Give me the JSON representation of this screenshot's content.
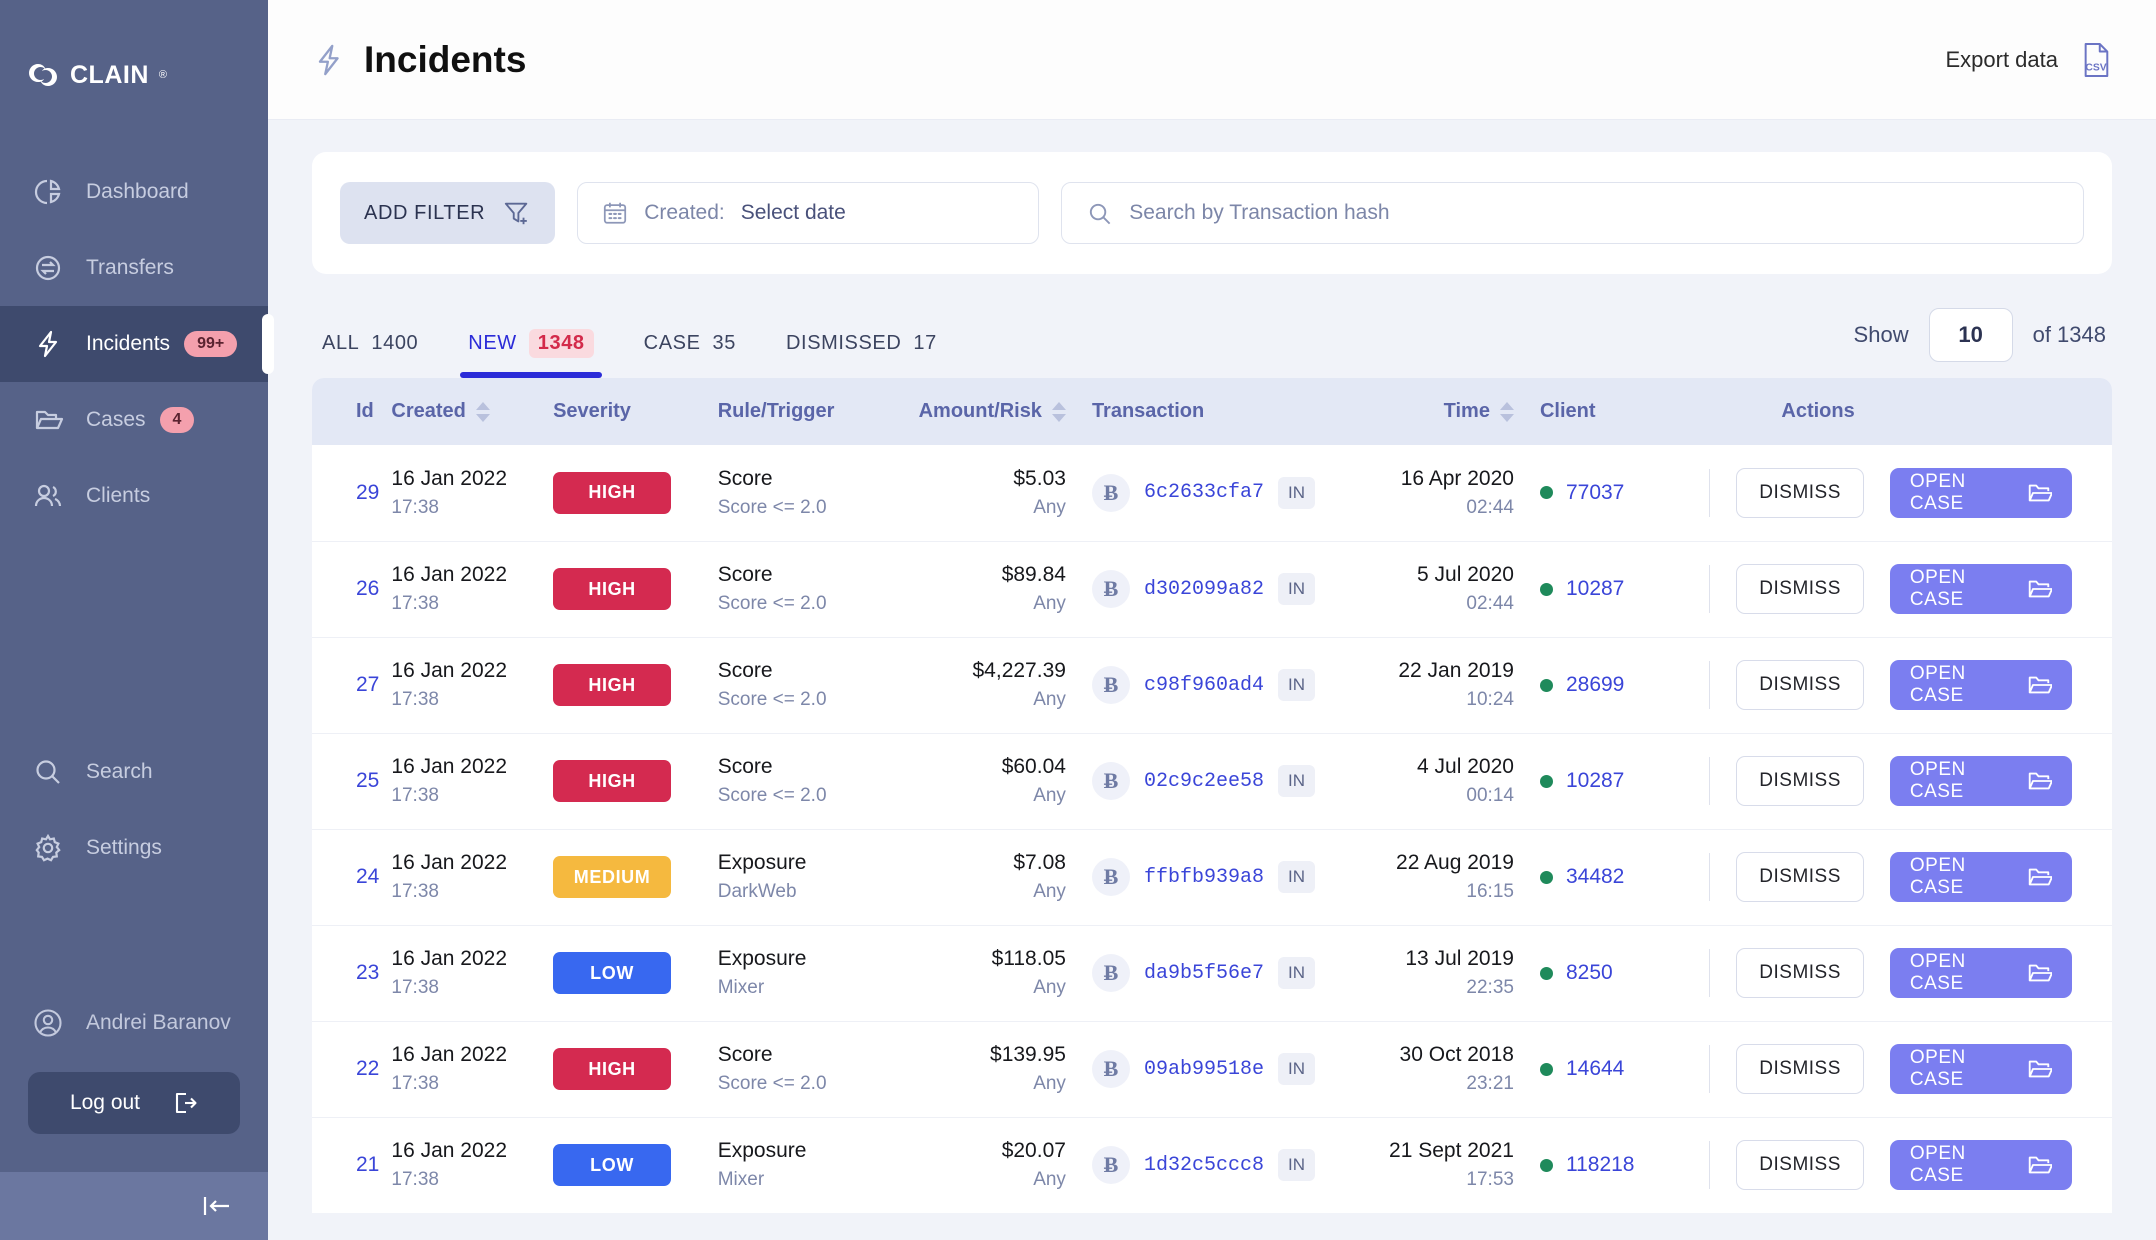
{
  "brand": {
    "name": "CLAIN",
    "registered": "®"
  },
  "sidebar": {
    "items": [
      {
        "label": "Dashboard",
        "icon": "pie-chart-icon",
        "badge": null,
        "active": false
      },
      {
        "label": "Transfers",
        "icon": "transfers-icon",
        "badge": null,
        "active": false
      },
      {
        "label": "Incidents",
        "icon": "bolt-icon",
        "badge": "99+",
        "active": true
      },
      {
        "label": "Cases",
        "icon": "folder-icon",
        "badge": "4",
        "active": false
      },
      {
        "label": "Clients",
        "icon": "users-icon",
        "badge": null,
        "active": false
      }
    ],
    "lower_items": [
      {
        "label": "Search",
        "icon": "search-icon"
      },
      {
        "label": "Settings",
        "icon": "gear-icon"
      }
    ],
    "profile": {
      "name": "Andrei Baranov",
      "icon": "user-circle-icon"
    },
    "logout": {
      "label": "Log out",
      "icon": "logout-icon"
    },
    "collapse": {
      "icon": "collapse-left-icon"
    }
  },
  "header": {
    "title": "Incidents",
    "title_icon": "bolt-icon",
    "export_label": "Export data",
    "export_icon": "csv-file-icon"
  },
  "filters": {
    "add_filter_label": "ADD FILTER",
    "add_filter_icon": "funnel-plus-icon",
    "created": {
      "icon": "calendar-icon",
      "label": "Created:",
      "value": "Select date"
    },
    "search": {
      "icon": "search-icon",
      "placeholder": "Search by Transaction hash"
    }
  },
  "tabs": [
    {
      "label": "ALL",
      "count": "1400",
      "active": false
    },
    {
      "label": "NEW",
      "count": "1348",
      "active": true
    },
    {
      "label": "CASE",
      "count": "35",
      "active": false
    },
    {
      "label": "DISMISSED",
      "count": "17",
      "active": false
    }
  ],
  "pagination": {
    "show_label": "Show",
    "page_size": "10",
    "of_label": "of 1348"
  },
  "table": {
    "columns": [
      {
        "key": "id",
        "label": "Id",
        "sortable": false
      },
      {
        "key": "created",
        "label": "Created",
        "sortable": true
      },
      {
        "key": "severity",
        "label": "Severity",
        "sortable": false
      },
      {
        "key": "rule",
        "label": "Rule/Trigger",
        "sortable": false
      },
      {
        "key": "amount",
        "label": "Amount/Risk",
        "sortable": true
      },
      {
        "key": "transaction",
        "label": "Transaction",
        "sortable": false
      },
      {
        "key": "time",
        "label": "Time",
        "sortable": true
      },
      {
        "key": "client",
        "label": "Client",
        "sortable": false
      },
      {
        "key": "actions",
        "label": "Actions",
        "sortable": false
      }
    ],
    "row_actions": {
      "dismiss_label": "DISMISS",
      "open_case_label": "OPEN CASE",
      "open_case_icon": "folder-open-icon"
    },
    "rows": [
      {
        "id": "29",
        "created_date": "16 Jan 2022",
        "created_time": "17:38",
        "severity": "HIGH",
        "rule": "Score",
        "trigger": "Score <= 2.0",
        "amount": "$5.03",
        "risk": "Any",
        "coin": "btc-icon",
        "hash": "6c2633cfa7",
        "direction": "IN",
        "time_date": "16 Apr 2020",
        "time_time": "02:44",
        "client": "77037"
      },
      {
        "id": "26",
        "created_date": "16 Jan 2022",
        "created_time": "17:38",
        "severity": "HIGH",
        "rule": "Score",
        "trigger": "Score <= 2.0",
        "amount": "$89.84",
        "risk": "Any",
        "coin": "btc-icon",
        "hash": "d302099a82",
        "direction": "IN",
        "time_date": "5 Jul 2020",
        "time_time": "02:44",
        "client": "10287"
      },
      {
        "id": "27",
        "created_date": "16 Jan 2022",
        "created_time": "17:38",
        "severity": "HIGH",
        "rule": "Score",
        "trigger": "Score <= 2.0",
        "amount": "$4,227.39",
        "risk": "Any",
        "coin": "btc-icon",
        "hash": "c98f960ad4",
        "direction": "IN",
        "time_date": "22 Jan 2019",
        "time_time": "10:24",
        "client": "28699"
      },
      {
        "id": "25",
        "created_date": "16 Jan 2022",
        "created_time": "17:38",
        "severity": "HIGH",
        "rule": "Score",
        "trigger": "Score <= 2.0",
        "amount": "$60.04",
        "risk": "Any",
        "coin": "btc-icon",
        "hash": "02c9c2ee58",
        "direction": "IN",
        "time_date": "4 Jul 2020",
        "time_time": "00:14",
        "client": "10287"
      },
      {
        "id": "24",
        "created_date": "16 Jan 2022",
        "created_time": "17:38",
        "severity": "MEDIUM",
        "rule": "Exposure",
        "trigger": "DarkWeb",
        "amount": "$7.08",
        "risk": "Any",
        "coin": "btc-icon",
        "hash": "ffbfb939a8",
        "direction": "IN",
        "time_date": "22 Aug 2019",
        "time_time": "16:15",
        "client": "34482"
      },
      {
        "id": "23",
        "created_date": "16 Jan 2022",
        "created_time": "17:38",
        "severity": "LOW",
        "rule": "Exposure",
        "trigger": "Mixer",
        "amount": "$118.05",
        "risk": "Any",
        "coin": "btc-icon",
        "hash": "da9b5f56e7",
        "direction": "IN",
        "time_date": "13 Jul 2019",
        "time_time": "22:35",
        "client": "8250"
      },
      {
        "id": "22",
        "created_date": "16 Jan 2022",
        "created_time": "17:38",
        "severity": "HIGH",
        "rule": "Score",
        "trigger": "Score <= 2.0",
        "amount": "$139.95",
        "risk": "Any",
        "coin": "btc-icon",
        "hash": "09ab99518e",
        "direction": "IN",
        "time_date": "30 Oct 2018",
        "time_time": "23:21",
        "client": "14644"
      },
      {
        "id": "21",
        "created_date": "16 Jan 2022",
        "created_time": "17:38",
        "severity": "LOW",
        "rule": "Exposure",
        "trigger": "Mixer",
        "amount": "$20.07",
        "risk": "Any",
        "coin": "btc-icon",
        "hash": "1d32c5ccc8",
        "direction": "IN",
        "time_date": "21 Sept 2021",
        "time_time": "17:53",
        "client": "118218"
      }
    ]
  },
  "colors": {
    "sidebar_bg": "#566288",
    "sidebar_active": "#3e4a6d",
    "accent_blue": "#2b2bd8",
    "severity_high": "#d42a50",
    "severity_medium": "#f5b93f",
    "severity_low": "#3868f0",
    "open_case": "#7b7ef0",
    "client_dot_green": "#1f8a5b",
    "badge_pink": "#f4a0ad"
  }
}
